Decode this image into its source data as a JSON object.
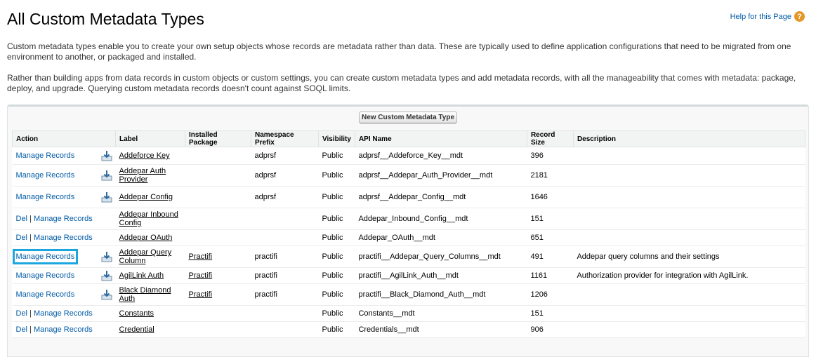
{
  "page": {
    "title": "All Custom Metadata Types",
    "help_label": "Help for this Page",
    "description_1": "Custom metadata types enable you to create your own setup objects whose records are metadata rather than data. These are typically used to define application configurations that need to be migrated from one environment to another, or packaged and installed.",
    "description_2": "Rather than building apps from data records in custom objects or custom settings, you can create custom metadata types and add metadata records, with all the manageability that comes with metadata: package, deploy, and upgrade. Querying custom metadata records doesn't count against SOQL limits."
  },
  "toolbar": {
    "new_button": "New Custom Metadata Type"
  },
  "table": {
    "headers": {
      "action": "Action",
      "label": "Label",
      "installed_package": "Installed Package",
      "namespace_prefix": "Namespace Prefix",
      "visibility": "Visibility",
      "api_name": "API Name",
      "record_size": "Record Size",
      "description": "Description"
    },
    "del_label": "Del",
    "separator": "|",
    "manage_label": "Manage Records",
    "rows": [
      {
        "label": "Addeforce Key",
        "package": "",
        "namespace": "adprsf",
        "visibility": "Public",
        "api": "adprsf__Addeforce_Key__mdt",
        "size": "396",
        "description": "",
        "has_del": false,
        "has_icon": true
      },
      {
        "label": "Addepar Auth Provider",
        "package": "",
        "namespace": "adprsf",
        "visibility": "Public",
        "api": "adprsf__Addepar_Auth_Provider__mdt",
        "size": "2181",
        "description": "",
        "has_del": false,
        "has_icon": true
      },
      {
        "label": "Addepar Config",
        "package": "",
        "namespace": "adprsf",
        "visibility": "Public",
        "api": "adprsf__Addepar_Config__mdt",
        "size": "1646",
        "description": "",
        "has_del": false,
        "has_icon": true
      },
      {
        "label": "Addepar Inbound Config",
        "package": "",
        "namespace": "",
        "visibility": "Public",
        "api": "Addepar_Inbound_Config__mdt",
        "size": "151",
        "description": "",
        "has_del": true,
        "has_icon": false
      },
      {
        "label": "Addepar OAuth",
        "package": "",
        "namespace": "",
        "visibility": "Public",
        "api": "Addepar_OAuth__mdt",
        "size": "651",
        "description": "",
        "has_del": true,
        "has_icon": false
      },
      {
        "label": "Addepar Query Column",
        "package": "Practifi",
        "namespace": "practifi",
        "visibility": "Public",
        "api": "practifi__Addepar_Query_Columns__mdt",
        "size": "491",
        "description": "Addepar query columns and their settings",
        "has_del": false,
        "has_icon": true
      },
      {
        "label": "AgilLink Auth",
        "package": "Practifi",
        "namespace": "practifi",
        "visibility": "Public",
        "api": "practifi__AgilLink_Auth__mdt",
        "size": "1161",
        "description": "Authorization provider for integration with AgilLink.",
        "has_del": false,
        "has_icon": true
      },
      {
        "label": "Black Diamond Auth",
        "package": "Practifi",
        "namespace": "practifi",
        "visibility": "Public",
        "api": "practifi__Black_Diamond_Auth__mdt",
        "size": "1206",
        "description": "",
        "has_del": false,
        "has_icon": true
      },
      {
        "label": "Constants",
        "package": "",
        "namespace": "",
        "visibility": "Public",
        "api": "Constants__mdt",
        "size": "151",
        "description": "",
        "has_del": true,
        "has_icon": false
      },
      {
        "label": "Credential",
        "package": "",
        "namespace": "",
        "visibility": "Public",
        "api": "Credentials__mdt",
        "size": "906",
        "description": "",
        "has_del": true,
        "has_icon": false
      }
    ]
  },
  "colors": {
    "link": "#015ba7",
    "highlight": "#1ba6e0",
    "help_icon": "#e49726"
  },
  "icons": {
    "help": "question-mark-icon",
    "install": "download-icon"
  }
}
